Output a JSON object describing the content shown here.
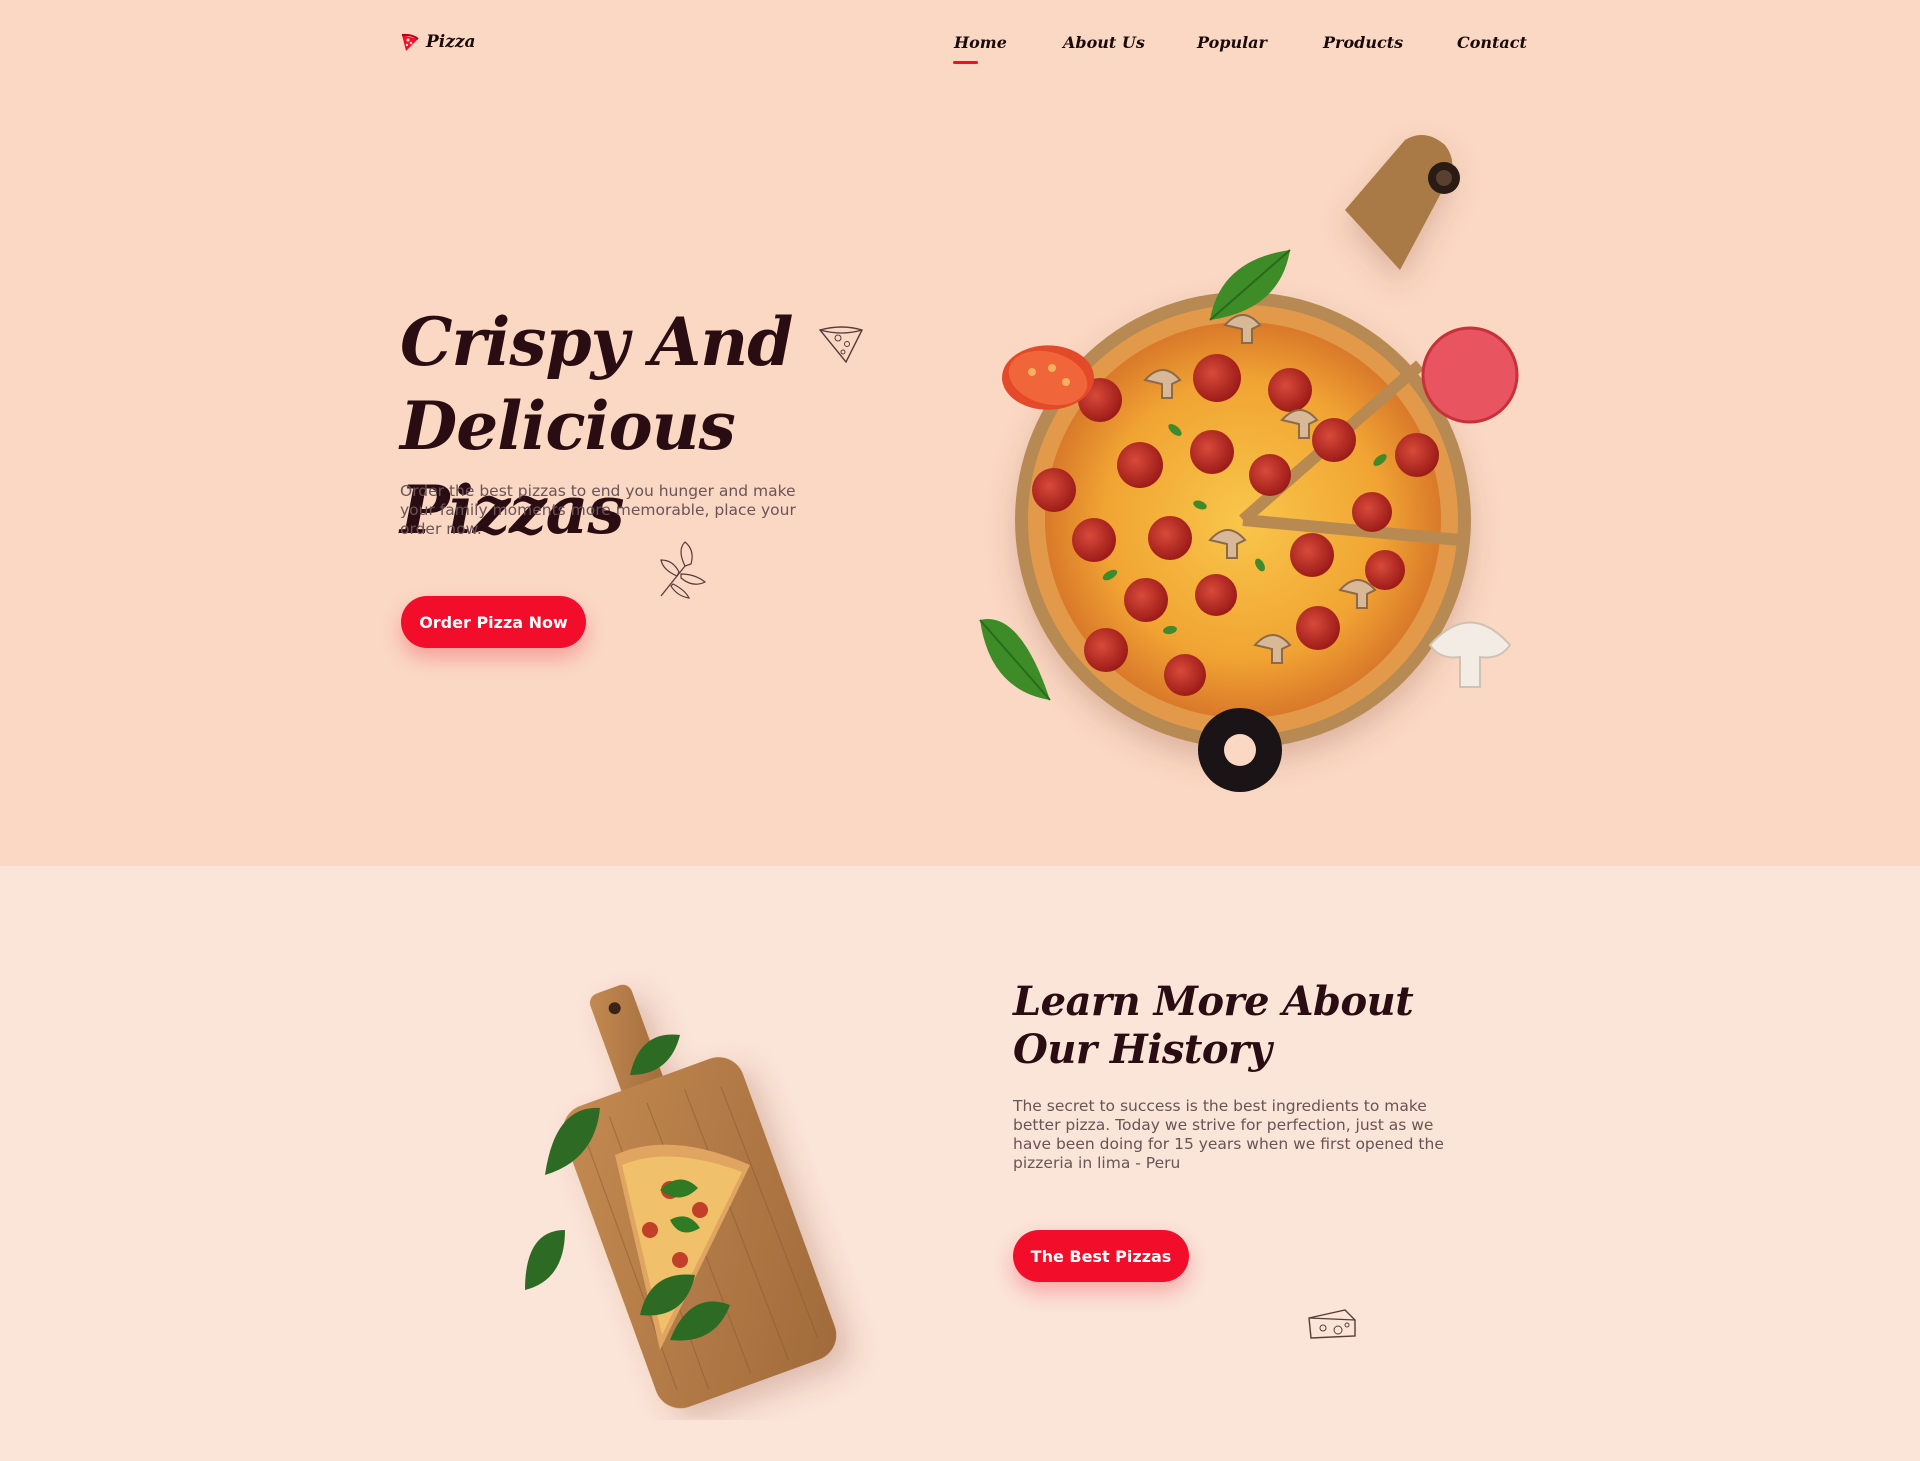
{
  "brand": {
    "name": "Pizza",
    "icon": "pizza-slice-icon",
    "accent": "#f20d2a"
  },
  "nav": {
    "items": [
      {
        "label": "Home",
        "active": true
      },
      {
        "label": "About Us"
      },
      {
        "label": "Popular"
      },
      {
        "label": "Products"
      },
      {
        "label": "Contact"
      }
    ]
  },
  "hero": {
    "title_line1": "Crispy And",
    "title_line2": "Delicious Pizzas",
    "description": "Order the best pizzas to end you hunger and make your family moments more memorable, place your order now.",
    "cta": "Order Pizza Now",
    "image": "pizza-on-board-image"
  },
  "about": {
    "title_line1": "Learn More About",
    "title_line2": "Our History",
    "description": "The secret to success is the best ingredients to make better pizza. Today we strive for perfection, just as we have been doing for 15 years when we first opened the pizzeria in lima - Peru",
    "cta": "The Best Pizzas",
    "image": "pizza-slice-on-board-image"
  },
  "colors": {
    "hero_bg": "#fad8c4",
    "about_bg": "#fbe4d8",
    "heading": "#2a0d12",
    "body_text": "#6b5356"
  }
}
